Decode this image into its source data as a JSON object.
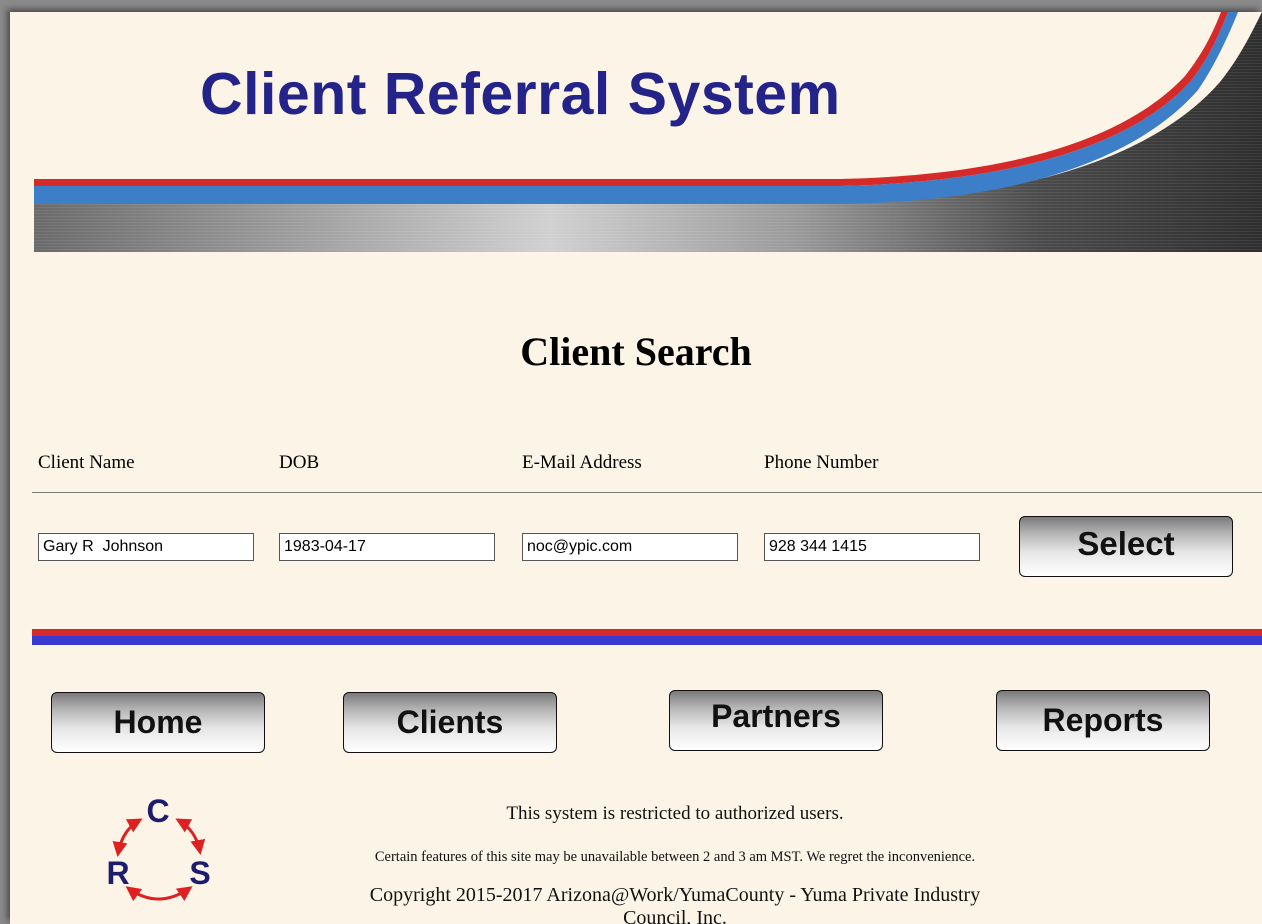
{
  "banner": {
    "title": "Client Referral System"
  },
  "search": {
    "heading": "Client Search",
    "columns": [
      "Client Name",
      "DOB",
      "E-Mail Address",
      "Phone Number"
    ],
    "fields": {
      "client_name": "Gary R  Johnson",
      "dob": "1983-04-17",
      "email": "noc@ypic.com",
      "phone": "928 344 1415"
    },
    "select_label": "Select"
  },
  "nav": {
    "home": "Home",
    "clients": "Clients",
    "partners": "Partners",
    "reports": "Reports"
  },
  "logo": {
    "letters": [
      "C",
      "R",
      "S"
    ]
  },
  "footer": {
    "restricted": "This system is restricted to authorized users.",
    "maintenance": "Certain features of this site may be unavailable between 2 and 3 am MST. We regret the inconvenience.",
    "copyright": "Copyright 2015-2017 Arizona@Work/YumaCounty - Yuma Private Industry Council, Inc."
  },
  "colors": {
    "background": "#fcf4e6",
    "title_blue": "#23238a",
    "stripe_red": "#d42a2a",
    "stripe_blue": "#3a3ad0",
    "banner_blue": "#3d7ec8",
    "logo_navy": "#1d1d6e",
    "logo_arrow_red": "#e02020"
  }
}
